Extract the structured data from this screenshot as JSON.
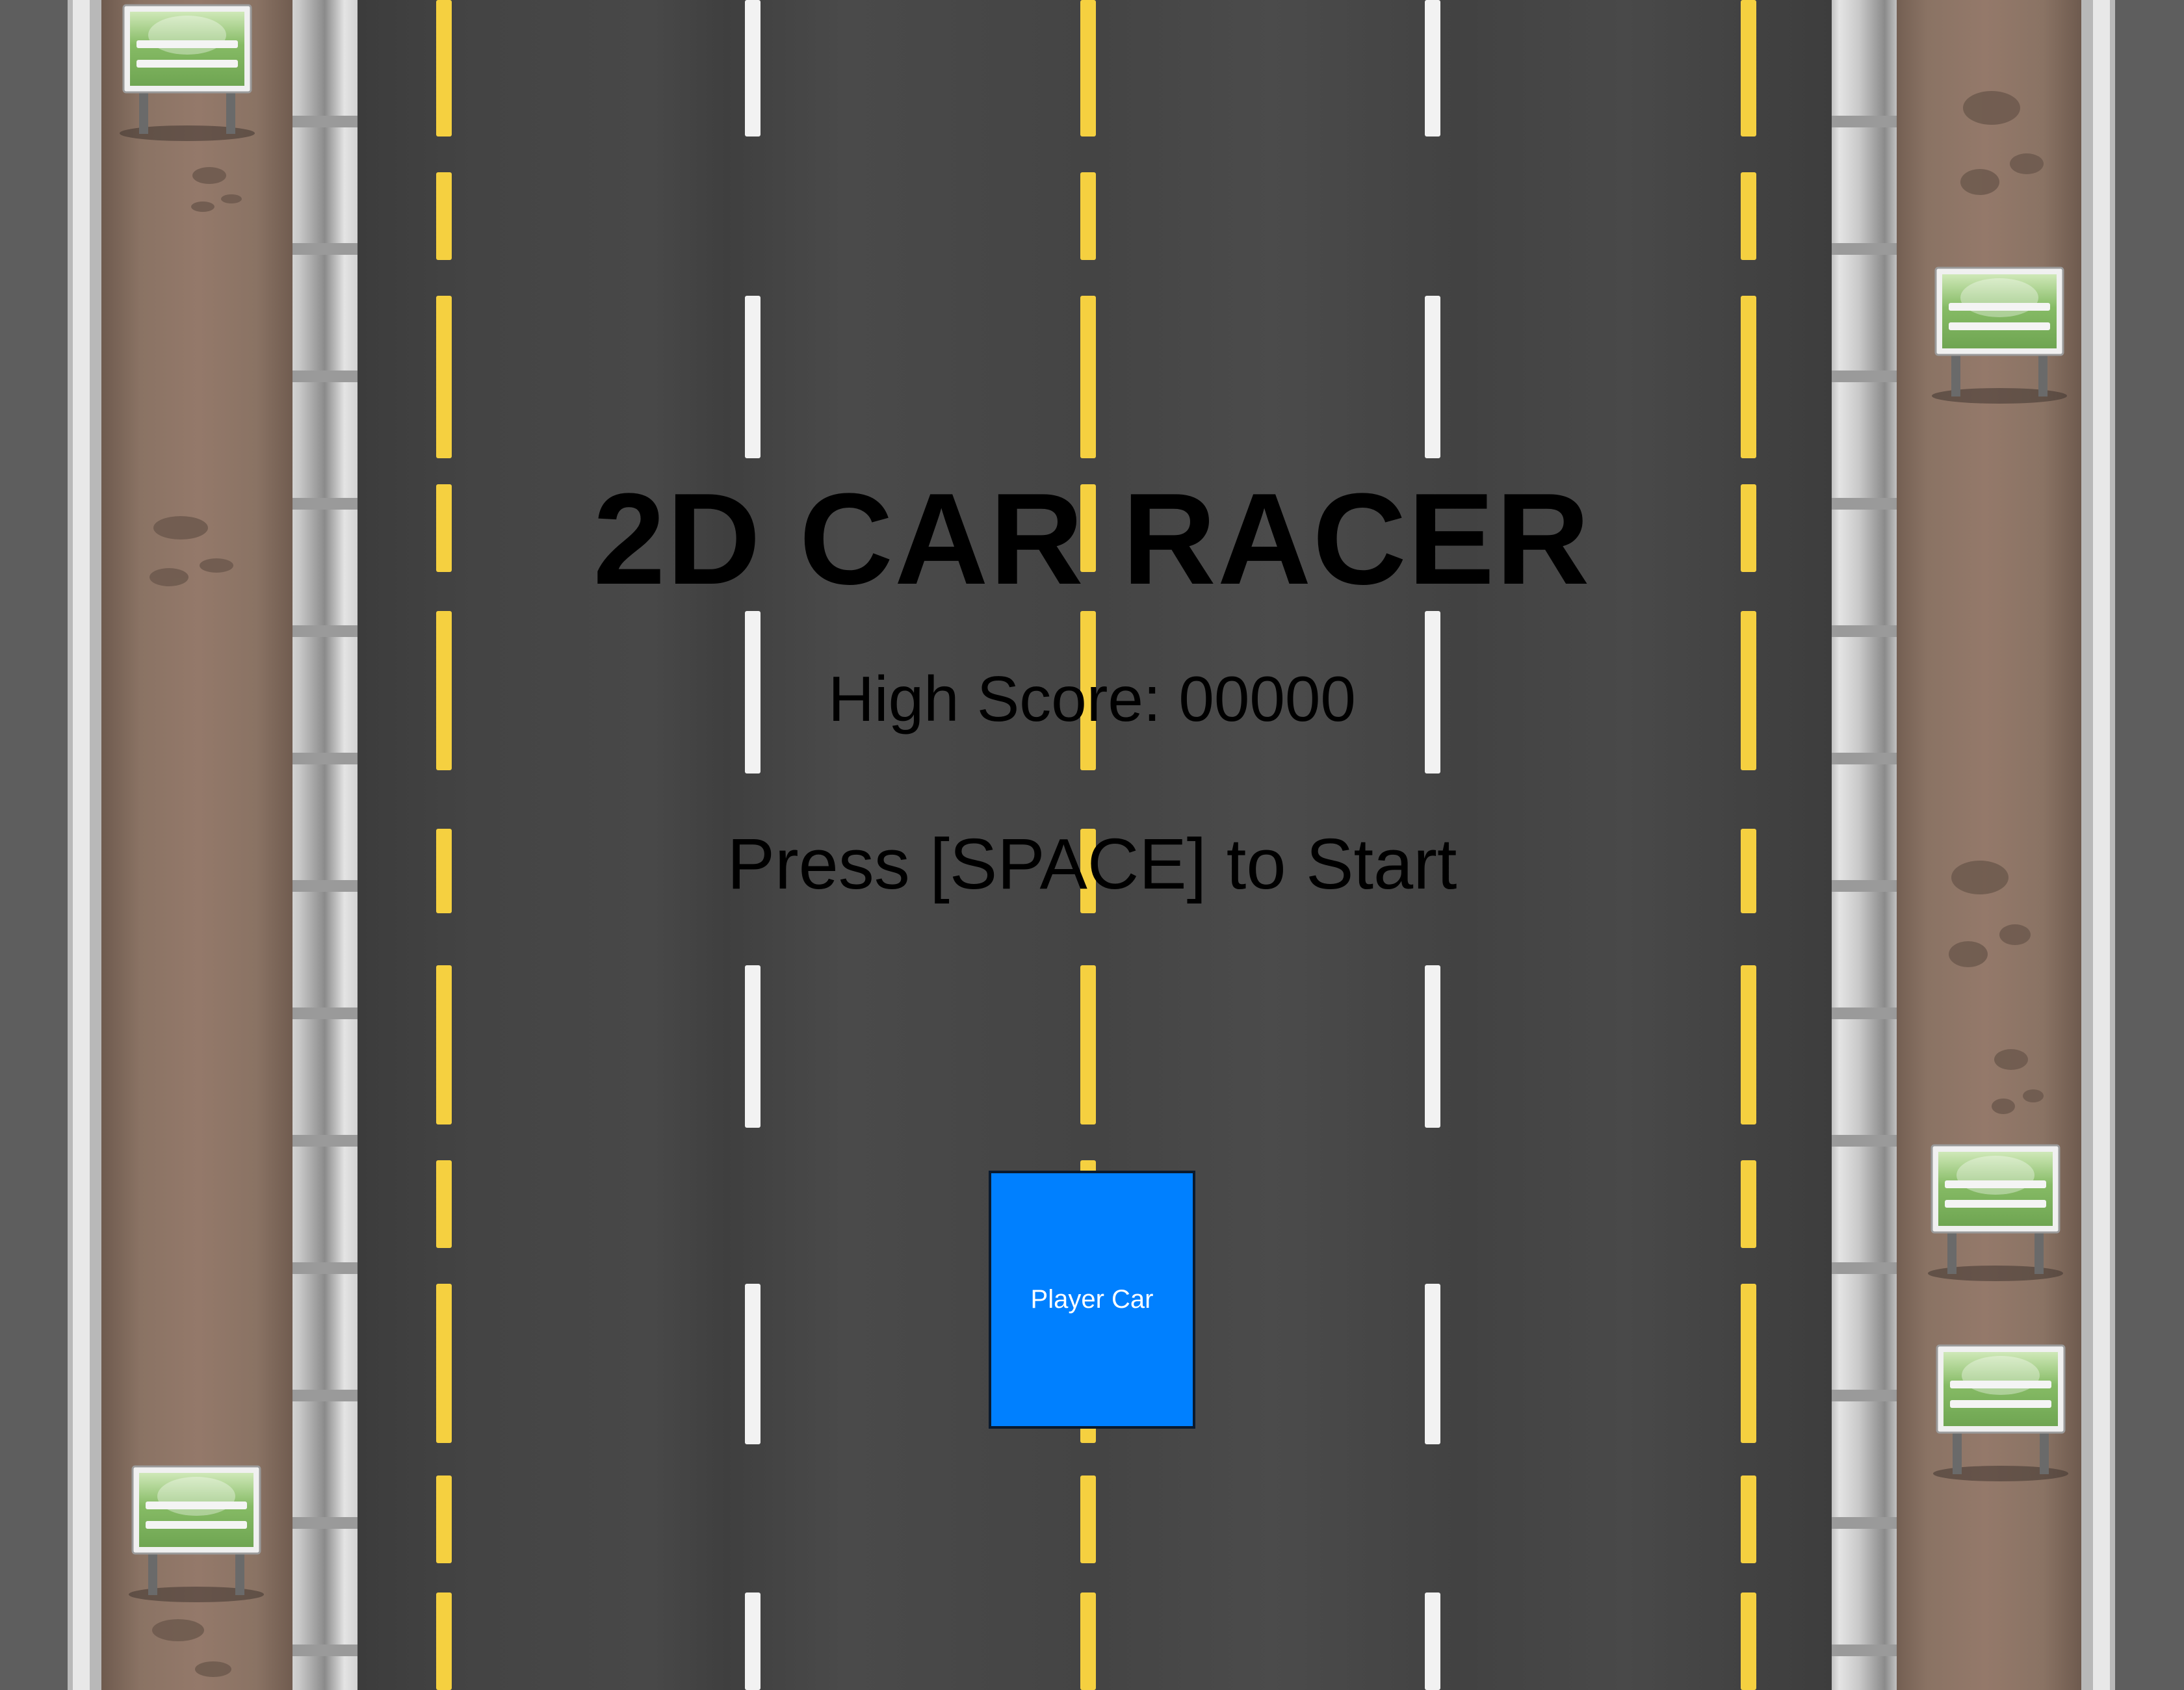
{
  "title": "2D CAR RACER",
  "high_score": {
    "text": "High Score: 00000",
    "value": "00000"
  },
  "prompt": "Press [SPACE] to Start",
  "player_car": {
    "label": "Player Car",
    "color": "#0080ff"
  },
  "colors": {
    "asphalt": "#474747",
    "yellow_line": "#f5d040",
    "white_line": "#f2f2f2",
    "dirt": "#8c7566",
    "sign_green": "#7cb55e",
    "guardrail": "#d4d4d4",
    "outer_gray": "#5e5e5e"
  },
  "icons": [
    "roadside-sign-icon",
    "guardrail-icon",
    "lane-marking-icon"
  ]
}
